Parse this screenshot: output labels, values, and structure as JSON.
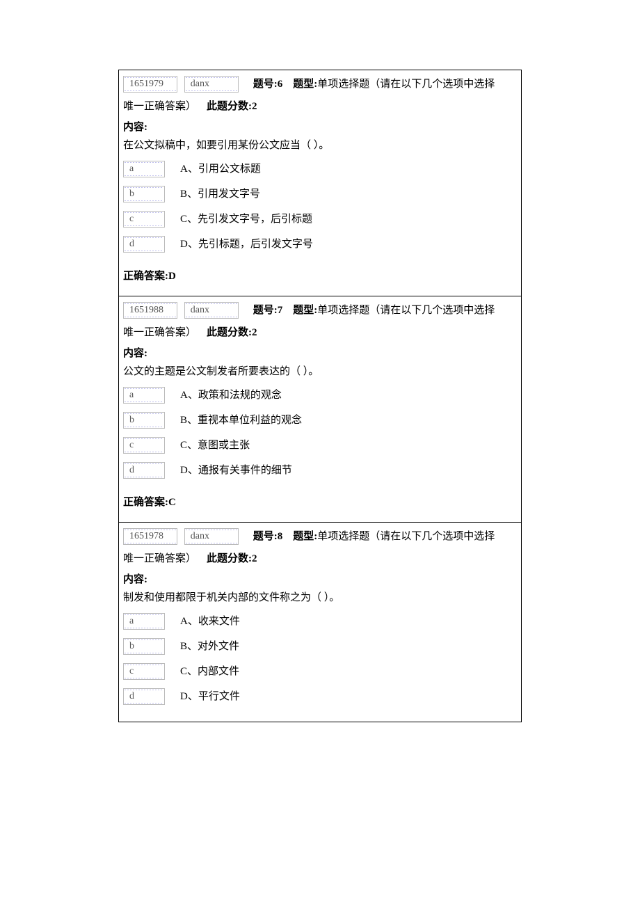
{
  "labels": {
    "question_number_prefix": "题号:",
    "question_type_prefix": "题型:",
    "question_type_value": "单项选择题（请在以下几个选项中选择",
    "question_type_tail": "唯一正确答案）",
    "score_prefix": "此题分数:",
    "content_label": "内容:",
    "answer_prefix": "正确答案:"
  },
  "questions": [
    {
      "id_field": "1651979",
      "code_field": "danx",
      "number": "6",
      "score": "2",
      "body": "在公文拟稿中，如要引用某份公文应当（ ）。",
      "options": [
        {
          "key": "a",
          "text": "A、引用公文标题"
        },
        {
          "key": "b",
          "text": "B、引用发文字号"
        },
        {
          "key": "c",
          "text": "C、先引发文字号，后引标题"
        },
        {
          "key": "d",
          "text": "D、先引标题，后引发文字号"
        }
      ],
      "answer": "D"
    },
    {
      "id_field": "1651988",
      "code_field": "danx",
      "number": "7",
      "score": "2",
      "body": "公文的主题是公文制发者所要表达的（ ）。",
      "options": [
        {
          "key": "a",
          "text": "A、政策和法规的观念"
        },
        {
          "key": "b",
          "text": "B、重视本单位利益的观念"
        },
        {
          "key": "c",
          "text": "C、意图或主张"
        },
        {
          "key": "d",
          "text": "D、通报有关事件的细节"
        }
      ],
      "answer": "C"
    },
    {
      "id_field": "1651978",
      "code_field": "danx",
      "number": "8",
      "score": "2",
      "body": "制发和使用都限于机关内部的文件称之为（ ）。",
      "options": [
        {
          "key": "a",
          "text": "A、收来文件"
        },
        {
          "key": "b",
          "text": "B、对外文件"
        },
        {
          "key": "c",
          "text": "C、内部文件"
        },
        {
          "key": "d",
          "text": "D、平行文件"
        }
      ],
      "answer": ""
    }
  ]
}
